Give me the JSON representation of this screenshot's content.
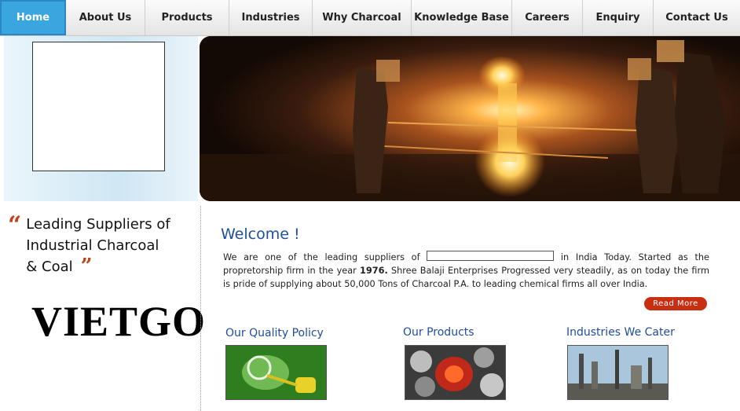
{
  "nav": {
    "items": [
      {
        "label": "Home",
        "active": true
      },
      {
        "label": "About Us"
      },
      {
        "label": "Products"
      },
      {
        "label": "Industries"
      },
      {
        "label": "Why Charcoal"
      },
      {
        "label": "Knowledge Base"
      },
      {
        "label": "Careers"
      },
      {
        "label": "Enquiry"
      },
      {
        "label": "Contact Us"
      }
    ]
  },
  "tagline": {
    "open_quote": "“",
    "line1": "Leading Suppliers of",
    "line2": "Industrial Charcoal",
    "line3": "& Coal",
    "close_quote": "”"
  },
  "watermark": "VIETGO",
  "welcome": {
    "title": "Welcome !",
    "text_before": "We are one of the leading suppliers of ",
    "text_after_1": " in India Today. Started as the propretorship firm in the year ",
    "year": "1976.",
    "text_after_2": " Shree Balaji Enterprises Progressed very steadily, as on today the firm is pride of supplying about 50,000 Tons of Charcoal P.A. to leading chemical firms all over India.",
    "read_more": "Read More"
  },
  "sections": [
    {
      "title": "Our Quality Policy"
    },
    {
      "title": "Our Products"
    },
    {
      "title": "Industries We Cater"
    }
  ],
  "colors": {
    "nav_active": "#3aa6e0",
    "heading_blue": "#1f4ea0",
    "accent_red": "#c72e12"
  }
}
